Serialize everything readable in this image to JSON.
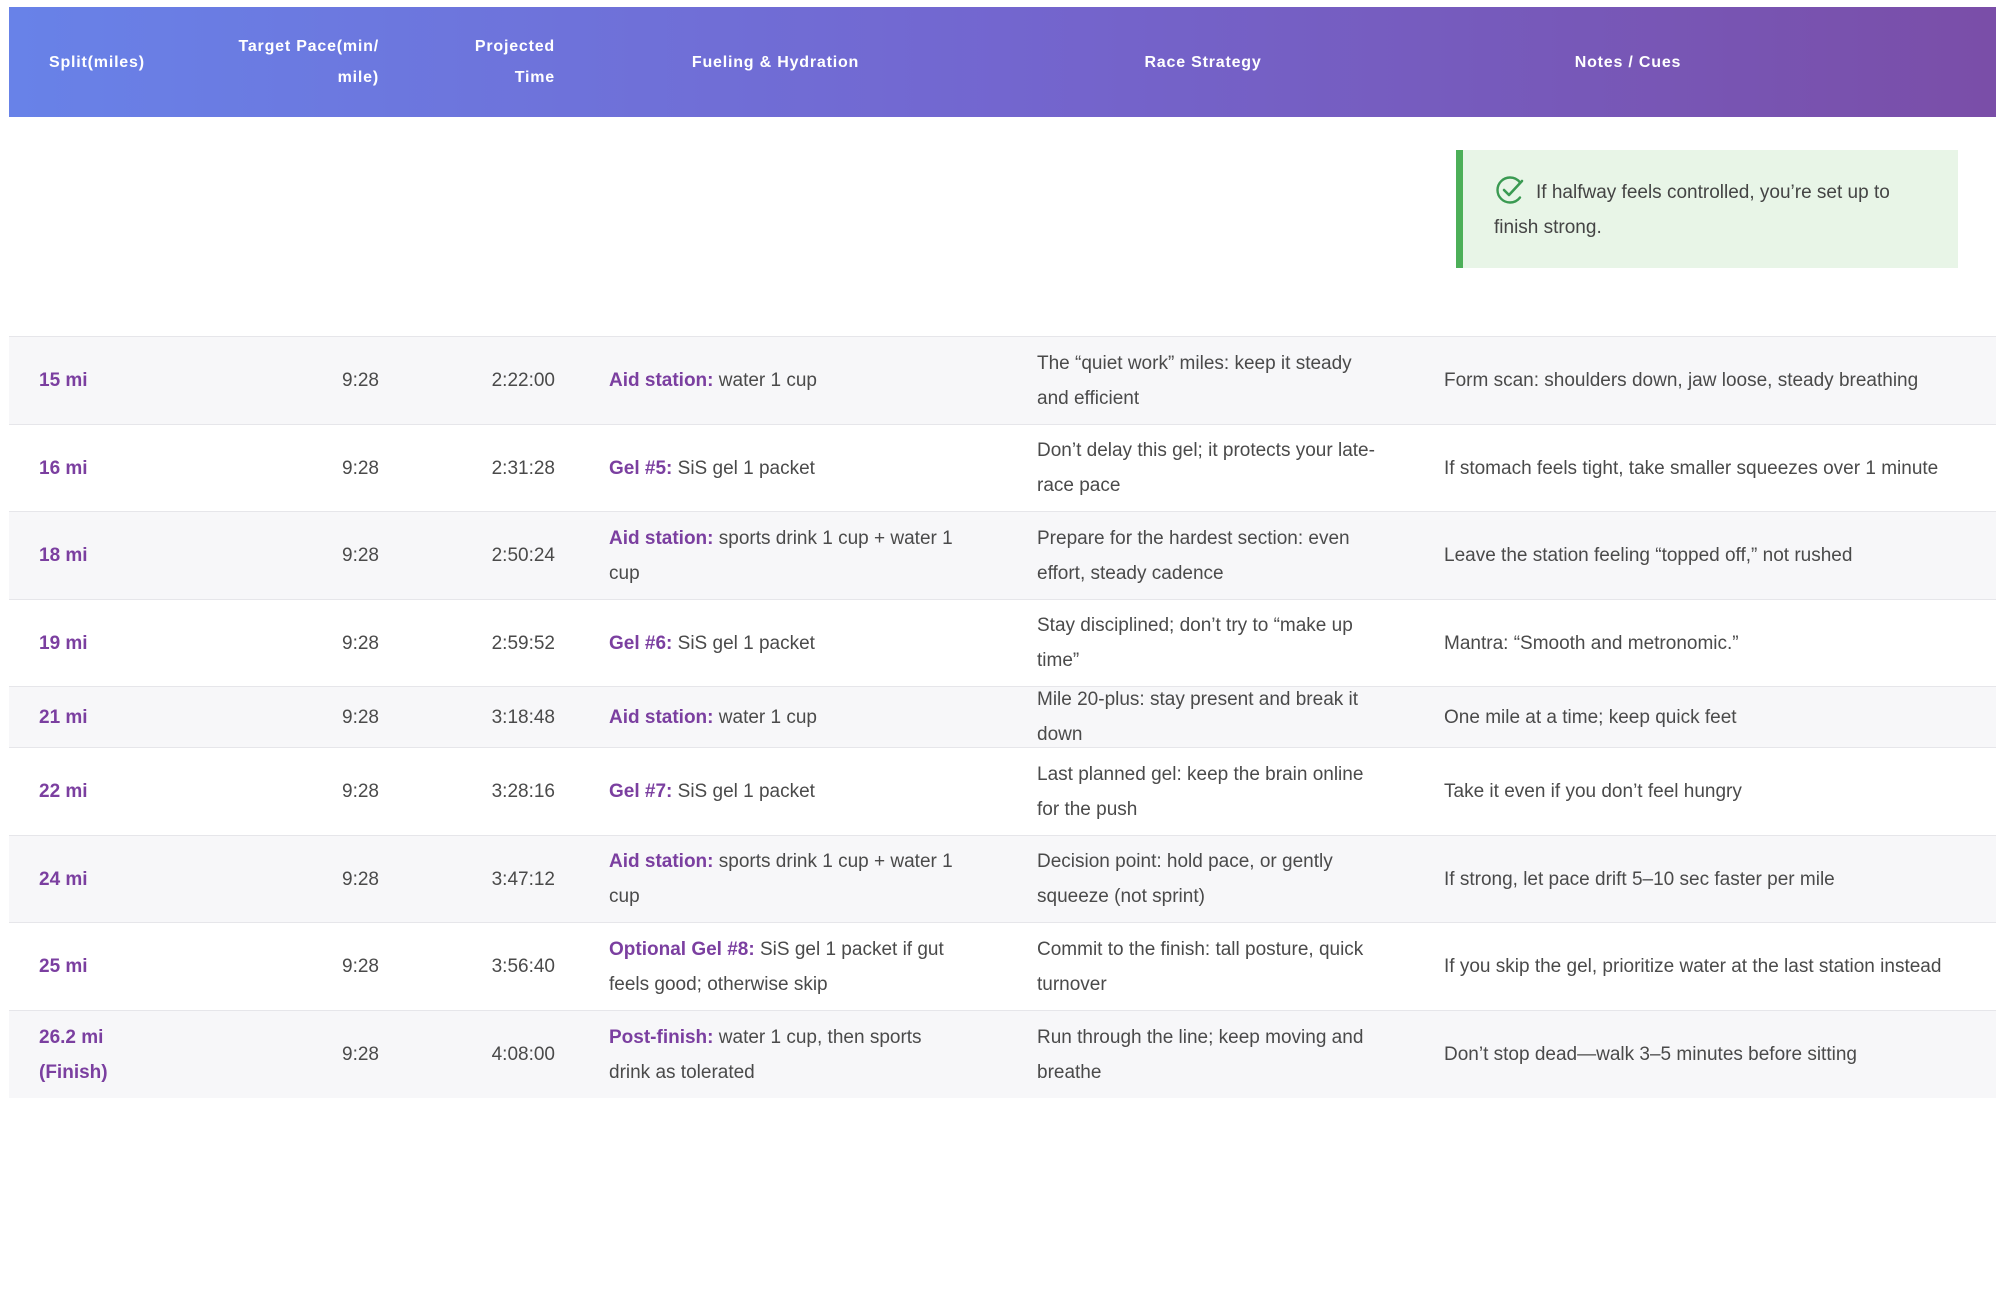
{
  "header": {
    "split": "Split(miles)",
    "pace_line1": "Target Pace(min/",
    "pace_line2": "mile)",
    "time_line1": "Projected",
    "time_line2": "Time",
    "fueling": "Fueling & Hydration",
    "strategy": "Race Strategy",
    "notes": "Notes / Cues"
  },
  "callout": {
    "icon": "check-circle-icon",
    "text": "If halfway feels controlled, you’re set up to finish strong."
  },
  "rows": [
    {
      "split": "15 mi",
      "pace": "9:28",
      "time": "2:22:00",
      "fuel_label": "Aid station:",
      "fuel_text": " water 1 cup",
      "strategy": "The “quiet work” miles: keep it steady and efficient",
      "notes": "Form scan: shoulders down, jaw loose, steady breathing"
    },
    {
      "split": "16 mi",
      "pace": "9:28",
      "time": "2:31:28",
      "fuel_label": "Gel #5:",
      "fuel_text": " SiS gel 1 packet",
      "strategy": "Don’t delay this gel; it protects your late-race pace",
      "notes": "If stomach feels tight, take smaller squeezes over 1 minute"
    },
    {
      "split": "18 mi",
      "pace": "9:28",
      "time": "2:50:24",
      "fuel_label": "Aid station:",
      "fuel_text": " sports drink 1 cup + water 1 cup",
      "strategy": "Prepare for the hardest section: even effort, steady cadence",
      "notes": "Leave the station feeling “topped off,” not rushed"
    },
    {
      "split": "19 mi",
      "pace": "9:28",
      "time": "2:59:52",
      "fuel_label": "Gel #6:",
      "fuel_text": " SiS gel 1 packet",
      "strategy": "Stay disciplined; don’t try to “make up time”",
      "notes": "Mantra: “Smooth and metronomic.”"
    },
    {
      "split": "21 mi",
      "pace": "9:28",
      "time": "3:18:48",
      "fuel_label": "Aid station:",
      "fuel_text": " water 1 cup",
      "strategy": "Mile 20-plus: stay present and break it down",
      "notes": "One mile at a time; keep quick feet"
    },
    {
      "split": "22 mi",
      "pace": "9:28",
      "time": "3:28:16",
      "fuel_label": "Gel #7:",
      "fuel_text": " SiS gel 1 packet",
      "strategy": "Last planned gel: keep the brain online for the push",
      "notes": "Take it even if you don’t feel hungry"
    },
    {
      "split": "24 mi",
      "pace": "9:28",
      "time": "3:47:12",
      "fuel_label": "Aid station:",
      "fuel_text": " sports drink 1 cup + water 1 cup",
      "strategy": "Decision point: hold pace, or gently squeeze (not sprint)",
      "notes": "If strong, let pace drift 5–10 sec faster per mile"
    },
    {
      "split": "25 mi",
      "pace": "9:28",
      "time": "3:56:40",
      "fuel_label": "Optional Gel #8:",
      "fuel_text": " SiS gel 1 packet if gut feels good; otherwise skip",
      "strategy": "Commit to the finish: tall posture, quick turnover",
      "notes": "If you skip the gel, prioritize water at the last station instead"
    },
    {
      "split": "26.2 mi (Finish)",
      "pace": "9:28",
      "time": "4:08:00",
      "fuel_label": "Post-finish:",
      "fuel_text": " water 1 cup, then sports drink as tolerated",
      "strategy": "Run through the line; keep moving and breathe",
      "notes": "Don’t stop dead—walk 3–5 minutes before sitting"
    }
  ],
  "colors": {
    "header_start": "#6882e8",
    "header_end": "#7a4ea8",
    "accent": "#7b3fa0",
    "callout_bg": "#e8f5e7",
    "callout_border": "#4caf58"
  }
}
